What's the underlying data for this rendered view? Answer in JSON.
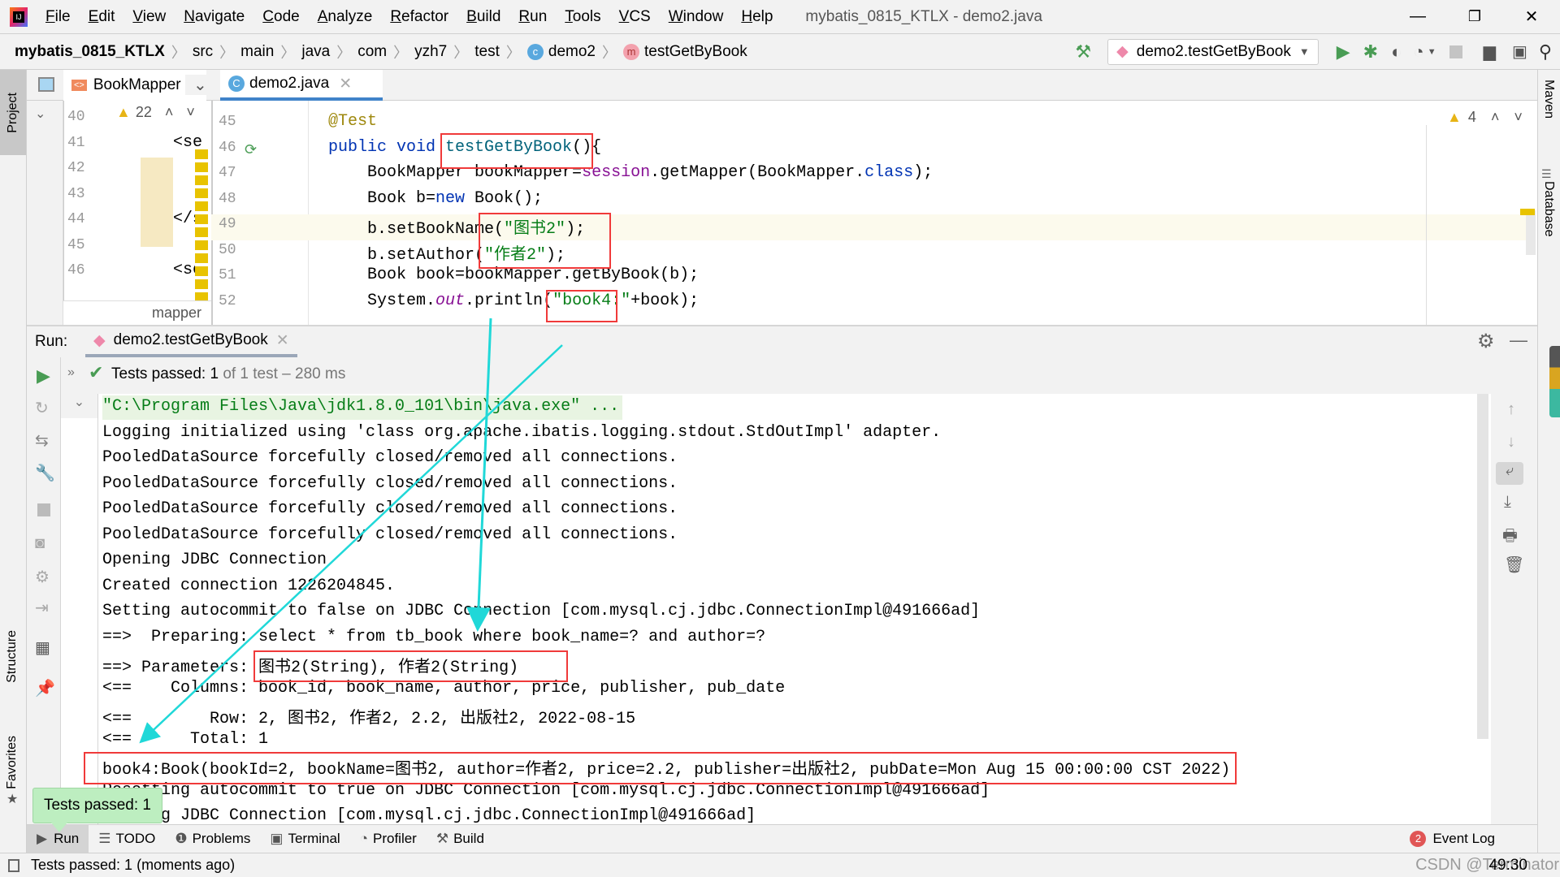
{
  "menu": [
    "File",
    "Edit",
    "View",
    "Navigate",
    "Code",
    "Analyze",
    "Refactor",
    "Build",
    "Run",
    "Tools",
    "VCS",
    "Window",
    "Help"
  ],
  "window_title": "mybatis_0815_KTLX - demo2.java",
  "breadcrumbs": [
    "mybatis_0815_KTLX",
    "src",
    "main",
    "java",
    "com",
    "yzh7",
    "test",
    "demo2",
    "testGetByBook"
  ],
  "run_config": "demo2.testGetByBook",
  "side_left": {
    "project": "Project",
    "structure": "Structure",
    "favorites": "Favorites"
  },
  "side_right": {
    "maven": "Maven",
    "database": "Database"
  },
  "tabs": [
    {
      "label": "BookMapper"
    },
    {
      "label": "demo2.java",
      "active": true
    }
  ],
  "mini_editor": {
    "warnings": "22",
    "line_numbers": [
      "40",
      "41",
      "42",
      "43",
      "44",
      "45",
      "46"
    ],
    "fragments": [
      "",
      "<se",
      "",
      "",
      "</s",
      "",
      "<se"
    ],
    "label": "mapper"
  },
  "editor": {
    "warnings": "4",
    "line_numbers": [
      "45",
      "46",
      "47",
      "48",
      "49",
      "50",
      "51",
      "52"
    ],
    "lines": [
      [
        [
          "@Test",
          "an"
        ]
      ],
      [
        [
          "public void ",
          "kw"
        ],
        [
          "testGetByBook",
          "fn"
        ],
        [
          "(){",
          ""
        ]
      ],
      [
        [
          "    BookMapper bookMapper=",
          ""
        ],
        [
          "session",
          "fld"
        ],
        [
          ".getMapper(BookMapper.",
          ""
        ],
        [
          "class",
          "kw"
        ],
        [
          ");",
          ""
        ]
      ],
      [
        [
          "    Book b=",
          ""
        ],
        [
          "new",
          "kw"
        ],
        [
          " Book();",
          ""
        ]
      ],
      [
        [
          "    b.setBookName(",
          ""
        ],
        [
          "\"图书2\"",
          "st"
        ],
        [
          ");",
          ""
        ]
      ],
      [
        [
          "    b.setAuthor(",
          ""
        ],
        [
          "\"作者2\"",
          "st"
        ],
        [
          ");",
          ""
        ]
      ],
      [
        [
          "    Book book=bookMapper.getByBook(b);",
          ""
        ]
      ],
      [
        [
          "    System.",
          ""
        ],
        [
          "out",
          "it"
        ],
        [
          ".println(",
          ""
        ],
        [
          "\"book4:\"",
          "st"
        ],
        [
          "+book);",
          ""
        ]
      ]
    ]
  },
  "run": {
    "label": "Run:",
    "tab": "demo2.testGetByBook",
    "status_prefix": "Tests passed:",
    "status_count": "1",
    "status_suffix": "of 1 test – 280 ms"
  },
  "console": [
    "\"C:\\Program Files\\Java\\jdk1.8.0_101\\bin\\java.exe\" ...",
    "Logging initialized using 'class org.apache.ibatis.logging.stdout.StdOutImpl' adapter.",
    "PooledDataSource forcefully closed/removed all connections.",
    "PooledDataSource forcefully closed/removed all connections.",
    "PooledDataSource forcefully closed/removed all connections.",
    "PooledDataSource forcefully closed/removed all connections.",
    "Opening JDBC Connection",
    "Created connection 1226204845.",
    "Setting autocommit to false on JDBC Connection [com.mysql.cj.jdbc.ConnectionImpl@491666ad]",
    "==>  Preparing: select * from tb_book where book_name=? and author=?",
    "==> Parameters: 图书2(String), 作者2(String)",
    "<==    Columns: book_id, book_name, author, price, publisher, pub_date",
    "<==        Row: 2, 图书2, 作者2, 2.2, 出版社2, 2022-08-15",
    "<==      Total: 1",
    "book4:Book(bookId=2, bookName=图书2, author=作者2, price=2.2, publisher=出版社2, pubDate=Mon Aug 15 00:00:00 CST 2022)",
    "Resetting autocommit to true on JDBC Connection [com.mysql.cj.jdbc.ConnectionImpl@491666ad]",
    "Closing JDBC Connection [com.mysql.cj.jdbc.ConnectionImpl@491666ad]"
  ],
  "tooltip": "Tests passed: 1",
  "bottom_tabs": [
    "Run",
    "TODO",
    "Problems",
    "Terminal",
    "Profiler",
    "Build"
  ],
  "event_log": {
    "label": "Event Log",
    "count": "2"
  },
  "status": {
    "message": "Tests passed: 1 (moments ago)",
    "position": "49:30",
    "watermark": "CSDN @Terminator of Bug"
  },
  "colors": {
    "annotation_box": "#f03a3a",
    "annotation_arrow": "#20d8d8",
    "pass_green": "#499c54"
  }
}
